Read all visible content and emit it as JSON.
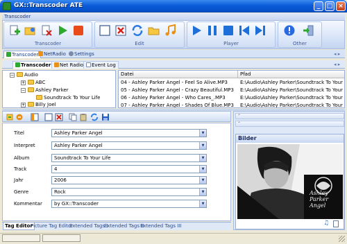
{
  "window": {
    "title": "GX::Transcoder ATE"
  },
  "ribbon": {
    "caption": "Transcoder",
    "groups": {
      "transcoder": "Transcoder",
      "edit": "Edit",
      "player": "Player",
      "other": "Other"
    }
  },
  "main_tabs": [
    "Transcoder",
    "NetRadio",
    "Settings"
  ],
  "sub_tabs": [
    "Transcoder",
    "Net Radio",
    "Event Log"
  ],
  "tree": {
    "items": [
      "Audio",
      "ABC",
      "Ashley Parker",
      "Soundtrack To Your Life",
      "Billy Joel"
    ]
  },
  "grid": {
    "headers": [
      "Datei",
      "Pfad"
    ],
    "rows": [
      {
        "datei": "04 - Ashley Parker Angel - Feel So Alive.MP3",
        "pfad": "E:\\Audio\\Ashley Parker\\Soundtrack To Your Life"
      },
      {
        "datei": "05 - Ashley Parker Angel - Crazy Beautiful.MP3",
        "pfad": "E:\\Audio\\Ashley Parker\\Soundtrack To Your Life"
      },
      {
        "datei": "06 - Ashley Parker Angel - Who Cares_.MP3",
        "pfad": "E:\\Audio\\Ashley Parker\\Soundtrack To Your Life"
      },
      {
        "datei": "07 - Ashley Parker Angel - Shades Of Blue.MP3",
        "pfad": "E:\\Audio\\Ashley Parker\\Soundtrack To Your Life"
      }
    ]
  },
  "tag_form": {
    "fields": [
      {
        "label": "Titel",
        "value": "Ashley Parker Angel"
      },
      {
        "label": "Interpret",
        "value": "Ashley Parker Angel"
      },
      {
        "label": "Album",
        "value": "Soundtrack To Your Life"
      },
      {
        "label": "Track",
        "value": "4"
      },
      {
        "label": "Jahr",
        "value": "2006"
      },
      {
        "label": "Genre",
        "value": "Rock"
      },
      {
        "label": "Kommentar",
        "value": "by GX::Transcoder"
      }
    ]
  },
  "bottom_tabs": [
    "Tag Editor",
    "Picture Tag Editor",
    "Extended Tags I",
    "Extended Tags II",
    "Extended Tags III"
  ],
  "right_panel": {
    "title": "Bilder",
    "cover_lines": [
      "Ashley",
      "Parker",
      "Angel"
    ]
  },
  "colors": {
    "titlebar": "#0a5bd8",
    "player_blue": "#1f6fd8",
    "play_green": "#2ea82e",
    "stop_red": "#e84a1a"
  }
}
